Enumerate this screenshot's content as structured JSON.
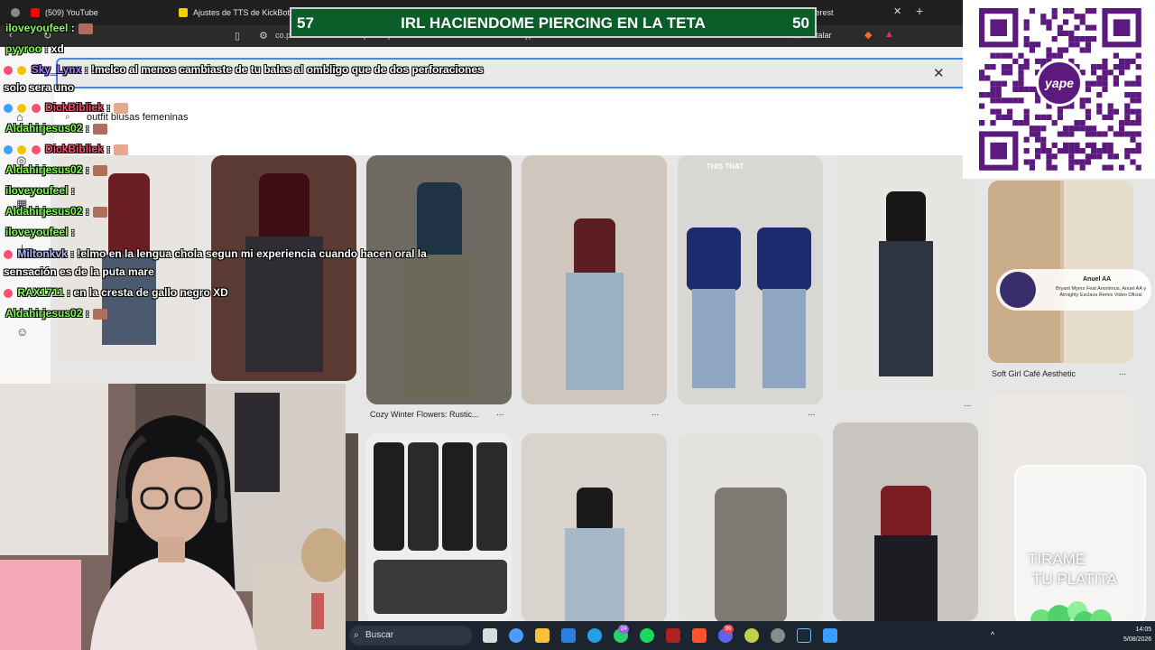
{
  "browser": {
    "tabs": [
      {
        "label": "(509) YouTube",
        "color": "#ff0000"
      },
      {
        "label": "Ajustes de TTS de KickBot",
        "color": "#f5d000"
      },
      {
        "label": "terest",
        "color": "#e60023"
      }
    ],
    "close_glyph": "✕",
    "new_tab_glyph": "+",
    "url": "co.pinterest.com/search/pins/?q=outfit%20blusas%20femeninas&rs=typed",
    "install_label": "Instalar"
  },
  "pinterest": {
    "search_suggestion": "outfit blusas femeninas",
    "search_icon": "search-icon",
    "close_glyph": "✕",
    "pins": [
      {
        "caption": "",
        "overlay_text": ""
      },
      {
        "caption": "",
        "overlay_text": ""
      },
      {
        "caption": "Cozy Winter Flowers: Rustic...",
        "overlay_text": ""
      },
      {
        "caption": "",
        "overlay_text": ""
      },
      {
        "caption": "",
        "overlay_text": "THIS        THAT"
      },
      {
        "caption": "",
        "overlay_text": ""
      },
      {
        "caption": "Soft Girl Café Aesthetic",
        "overlay_text": ""
      }
    ],
    "more_glyph": "..."
  },
  "overlay": {
    "title": "IRL HACIENDOME PIERCING EN LA TETA",
    "left_number": "57",
    "right_number": "50",
    "yape_logo": "yape",
    "jar_line1": "TIRAME",
    "jar_line2": "TU PLATITA",
    "music_title": "Anuel AA",
    "music_subtitle": "Bryant Myers Feat Anonimus, Anuel AA y Almighty Esclava Remix Video Oficial"
  },
  "chat": [
    {
      "user": "iloveyoufeel",
      "text": ":",
      "user_color": "#7cff4f"
    },
    {
      "user": "pyyroo",
      "text": ": xd",
      "user_color": "#7cff4f"
    },
    {
      "user": "Sky_Lynx",
      "text": ": !melco al menos cambiaste de tu balas al ombligo que de dos perforaciones",
      "user_color": "#a77bff"
    },
    {
      "user": "",
      "text": "solo sera uno",
      "user_color": "#ffffff"
    },
    {
      "user": "DickBibliek",
      "text": ":",
      "user_color": "#ff4f6e"
    },
    {
      "user": "Aldahirjesus02",
      "text": ":",
      "user_color": "#7cff4f"
    },
    {
      "user": "DickBibliek",
      "text": ":",
      "user_color": "#ff4f6e"
    },
    {
      "user": "Aldahirjesus02",
      "text": ":",
      "user_color": "#7cff4f"
    },
    {
      "user": "iloveyoufeel",
      "text": ":",
      "user_color": "#7cff4f"
    },
    {
      "user": "Aldahirjesus02",
      "text": ":",
      "user_color": "#7cff4f"
    },
    {
      "user": "iloveyoufeel",
      "text": ":",
      "user_color": "#7cff4f"
    },
    {
      "user": "Miltonkvk",
      "text": ": !elmo en la lengua chola segun mi experiencia cuando hacen oral la",
      "user_color": "#b0b8ff"
    },
    {
      "user": "",
      "text": "sensación es de la puta mare",
      "user_color": "#ffffff"
    },
    {
      "user": "RAX1711",
      "text": ": en la cresta de gallo negro XD",
      "user_color": "#7cff4f"
    },
    {
      "user": "Aldahirjesus02",
      "text": ":",
      "user_color": "#7cff4f"
    }
  ],
  "taskbar": {
    "search_label": "Buscar",
    "badge_whatsapp": "24",
    "badge_discord": "99",
    "time": "14:05",
    "date": "5/08/2026"
  },
  "colors": {
    "title_bg": "#0b5d2a",
    "yape_purple": "#5c1a7e",
    "taskbar_bg": "#1c2430"
  }
}
